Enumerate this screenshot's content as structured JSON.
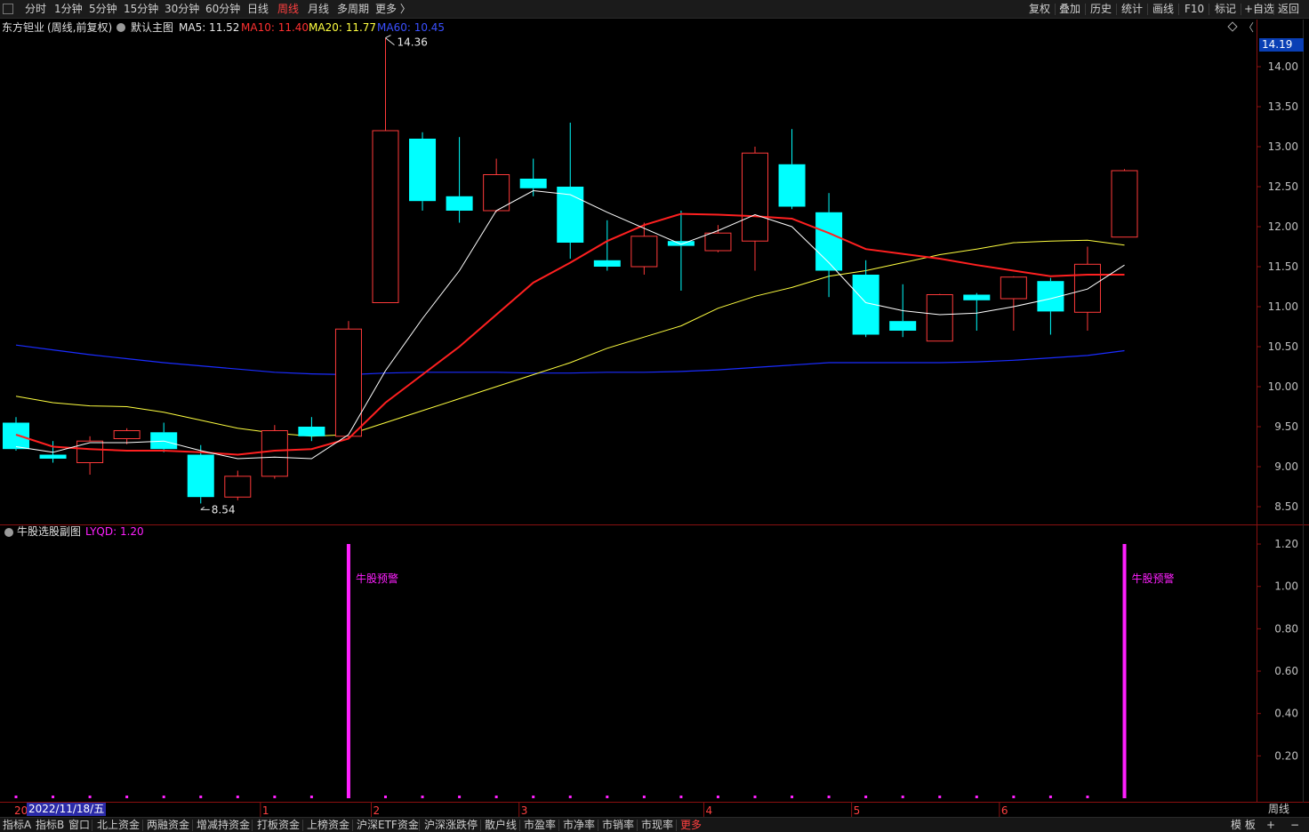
{
  "toolbar": {
    "timeframes": [
      "分时",
      "1分钟",
      "5分钟",
      "15分钟",
      "30分钟",
      "60分钟",
      "日线",
      "周线",
      "月线",
      "多周期",
      "更多 〉"
    ],
    "active_timeframe": "周线",
    "right_buttons": [
      "复权",
      "叠加",
      "历史",
      "统计",
      "画线",
      "F10",
      "标记",
      "+自选",
      "返回"
    ]
  },
  "main_chart": {
    "stock_name": "东方钽业",
    "period_label": "(周线,前复权)",
    "template_label": "默认主图",
    "ma": [
      {
        "name": "MA5",
        "value_text": "MA5: 11.52",
        "color": "#ffffff"
      },
      {
        "name": "MA10",
        "value_text": "MA10: 11.40",
        "color": "#ff3030"
      },
      {
        "name": "MA20",
        "value_text": "MA20: 11.77",
        "color": "#ffff40"
      },
      {
        "name": "MA60",
        "value_text": "MA60: 10.45",
        "color": "#2a3cff"
      }
    ],
    "current_price_tag": "14.19",
    "high_label": "14.36",
    "low_label": "8.54",
    "y_ticks": [
      "14.00",
      "13.50",
      "13.00",
      "12.50",
      "12.00",
      "11.50",
      "11.00",
      "10.50",
      "10.00",
      "9.50",
      "9.00",
      "8.50"
    ]
  },
  "sub_chart": {
    "title": "牛股选股副图",
    "indicator_text": "LYQD: 1.20",
    "signal_label": "牛股预警",
    "y_ticks": [
      "1.20",
      "1.00",
      "0.80",
      "0.60",
      "0.40",
      "0.20"
    ]
  },
  "x_axis": {
    "date_tag": "2022/11/18/五",
    "year_prefix": "20",
    "month_ticks": [
      "1",
      "2",
      "3",
      "4",
      "5",
      "6"
    ],
    "period_footer": "周线"
  },
  "bottom_tabs": [
    "指标A",
    "指标B",
    "窗口",
    "北上资金",
    "两融资金",
    "增减持资金",
    "打板资金",
    "上榜资金",
    "沪深ETF资金",
    "沪深涨跌停",
    "散户线",
    "市盈率",
    "市净率",
    "市销率",
    "市现率",
    "更多"
  ],
  "bottom_right": [
    "模 板",
    "+",
    "−"
  ],
  "colors": {
    "up": "#ff3a3a",
    "down": "#00ffff",
    "ma5": "#ffffff",
    "ma10": "#ff2020",
    "ma20": "#ffff40",
    "ma60": "#1a2cff",
    "signal": "#ff20ff",
    "axis": "#8a1010"
  },
  "chart_data": {
    "type": "candlestick",
    "candles": [
      {
        "o": 9.55,
        "h": 9.62,
        "l": 9.2,
        "c": 9.22
      },
      {
        "o": 9.15,
        "h": 9.32,
        "l": 9.05,
        "c": 9.1
      },
      {
        "o": 9.05,
        "h": 9.38,
        "l": 8.9,
        "c": 9.32
      },
      {
        "o": 9.35,
        "h": 9.48,
        "l": 9.28,
        "c": 9.45
      },
      {
        "o": 9.43,
        "h": 9.55,
        "l": 9.18,
        "c": 9.22
      },
      {
        "o": 9.15,
        "h": 9.27,
        "l": 8.54,
        "c": 8.62
      },
      {
        "o": 8.62,
        "h": 8.95,
        "l": 8.58,
        "c": 8.88
      },
      {
        "o": 8.88,
        "h": 9.52,
        "l": 8.85,
        "c": 9.45
      },
      {
        "o": 9.5,
        "h": 9.62,
        "l": 9.32,
        "c": 9.38
      },
      {
        "o": 9.38,
        "h": 10.82,
        "l": 9.35,
        "c": 10.72
      },
      {
        "o": 11.05,
        "h": 14.36,
        "l": 11.05,
        "c": 13.2
      },
      {
        "o": 13.1,
        "h": 13.18,
        "l": 12.2,
        "c": 12.32
      },
      {
        "o": 12.38,
        "h": 13.12,
        "l": 12.05,
        "c": 12.2
      },
      {
        "o": 12.2,
        "h": 12.85,
        "l": 12.18,
        "c": 12.65
      },
      {
        "o": 12.6,
        "h": 12.85,
        "l": 12.38,
        "c": 12.48
      },
      {
        "o": 12.5,
        "h": 13.3,
        "l": 11.6,
        "c": 11.8
      },
      {
        "o": 11.58,
        "h": 12.08,
        "l": 11.45,
        "c": 11.5
      },
      {
        "o": 11.5,
        "h": 12.05,
        "l": 11.4,
        "c": 11.88
      },
      {
        "o": 11.82,
        "h": 12.2,
        "l": 11.2,
        "c": 11.76
      },
      {
        "o": 11.7,
        "h": 12.02,
        "l": 11.68,
        "c": 11.92
      },
      {
        "o": 11.82,
        "h": 13.0,
        "l": 11.45,
        "c": 12.92
      },
      {
        "o": 12.78,
        "h": 13.22,
        "l": 12.22,
        "c": 12.25
      },
      {
        "o": 12.18,
        "h": 12.42,
        "l": 11.12,
        "c": 11.45
      },
      {
        "o": 11.4,
        "h": 11.58,
        "l": 10.62,
        "c": 10.65
      },
      {
        "o": 10.82,
        "h": 11.28,
        "l": 10.62,
        "c": 10.7
      },
      {
        "o": 10.57,
        "h": 11.16,
        "l": 10.57,
        "c": 11.15
      },
      {
        "o": 11.15,
        "h": 11.17,
        "l": 10.7,
        "c": 11.08
      },
      {
        "o": 11.1,
        "h": 11.38,
        "l": 10.7,
        "c": 11.37
      },
      {
        "o": 11.32,
        "h": 11.36,
        "l": 10.65,
        "c": 10.94
      },
      {
        "o": 10.93,
        "h": 11.75,
        "l": 10.7,
        "c": 11.53
      },
      {
        "o": 11.87,
        "h": 12.72,
        "l": 11.87,
        "c": 12.7
      }
    ],
    "ma5": [
      9.25,
      9.18,
      9.3,
      9.3,
      9.32,
      9.2,
      9.1,
      9.12,
      9.1,
      9.4,
      10.2,
      10.85,
      11.45,
      12.2,
      12.45,
      12.4,
      12.18,
      11.98,
      11.78,
      11.95,
      12.15,
      12.0,
      11.55,
      11.05,
      10.95,
      10.9,
      10.92,
      11.0,
      11.1,
      11.22,
      11.52
    ],
    "ma10": [
      9.4,
      9.25,
      9.22,
      9.2,
      9.2,
      9.18,
      9.15,
      9.2,
      9.22,
      9.35,
      9.8,
      10.15,
      10.5,
      10.9,
      11.3,
      11.55,
      11.82,
      12.02,
      12.16,
      12.15,
      12.13,
      12.1,
      11.92,
      11.72,
      11.66,
      11.6,
      11.52,
      11.45,
      11.38,
      11.4,
      11.4
    ],
    "ma20": [
      9.88,
      9.8,
      9.76,
      9.75,
      9.68,
      9.58,
      9.48,
      9.42,
      9.38,
      9.4,
      9.55,
      9.7,
      9.85,
      10.0,
      10.15,
      10.3,
      10.48,
      10.62,
      10.76,
      10.98,
      11.13,
      11.24,
      11.38,
      11.45,
      11.55,
      11.65,
      11.72,
      11.8,
      11.82,
      11.83,
      11.77
    ],
    "ma60": [
      10.52,
      10.46,
      10.4,
      10.35,
      10.3,
      10.26,
      10.22,
      10.18,
      10.16,
      10.15,
      10.17,
      10.18,
      10.18,
      10.18,
      10.17,
      10.17,
      10.18,
      10.18,
      10.19,
      10.21,
      10.24,
      10.27,
      10.3,
      10.3,
      10.3,
      10.3,
      10.31,
      10.33,
      10.36,
      10.39,
      10.45
    ],
    "signal_bars": [
      {
        "index": 9,
        "value": 1.2
      },
      {
        "index": 30,
        "value": 1.2
      }
    ],
    "price_ylim": [
      8.35,
      14.5
    ],
    "sub_ylim": [
      0,
      1.3
    ]
  }
}
